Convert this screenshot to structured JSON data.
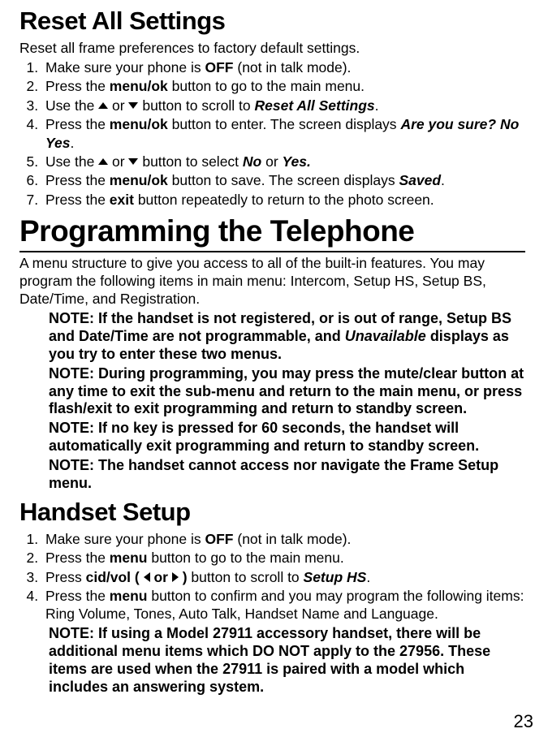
{
  "reset": {
    "title": "Reset All Settings",
    "intro": "Reset all frame preferences to factory default settings.",
    "s1a": "Make sure your phone is ",
    "s1b": "OFF",
    "s1c": " (not in talk mode).",
    "s2a": "Press the ",
    "s2b": "menu/ok",
    "s2c": " button to go to the main menu.",
    "s3a": "Use the ",
    "s3or": " or ",
    "s3b": " button to scroll to ",
    "s3c": "Reset All Settings",
    "s3d": ".",
    "s4a": "Press the ",
    "s4b": "menu/ok",
    "s4c": " button to enter. The screen displays ",
    "s4d": "Are you sure?  No  Yes",
    "s4e": ".",
    "s5a": "Use the ",
    "s5or": " or ",
    "s5b": " button to select ",
    "s5c": "No",
    "s5d": " or ",
    "s5e": "Yes.",
    "s6a": "Press the ",
    "s6b": "menu/ok",
    "s6c": " button to save. The screen displays ",
    "s6d": "Saved",
    "s6e": ".",
    "s7a": "Press the ",
    "s7b": "exit",
    "s7c": " button repeatedly to return to the photo screen."
  },
  "prog": {
    "title": "Programming the Telephone",
    "intro": "A menu structure to give you access to all of the built-in features. You may program the following items in main menu: Intercom, Setup HS, Setup BS, Date/Time, and Registration.",
    "n1a": "NOTE: If the handset is not registered, or is out of range, Setup BS and Date/Time are not programmable, and ",
    "n1b": "Unavailable",
    "n1c": " displays as you try to enter these two menus.",
    "n2": "NOTE: During programming, you may press the mute/clear button at any time to exit the sub-menu and return to the main menu, or press flash/exit to exit programming and return to standby screen.",
    "n3": "NOTE: If no key is pressed for 60 seconds, the handset will automatically exit programming and return to standby screen.",
    "n4": "NOTE: The handset cannot access nor navigate the Frame Setup menu."
  },
  "hs": {
    "title": "Handset Setup",
    "s1a": "Make sure your phone is ",
    "s1b": "OFF",
    "s1c": " (not in talk mode).",
    "s2a": "Press the ",
    "s2b": "menu",
    "s2c": " button to go to the main menu.",
    "s3a": "Press ",
    "s3b": "cid/vol ( ",
    "s3or": " or ",
    "s3b2": " )",
    "s3c": " button to scroll to ",
    "s3d": "Setup HS",
    "s3e": ".",
    "s4a": "Press the ",
    "s4b": "menu",
    "s4c": " button to confirm and you may program the following items: Ring Volume, Tones, Auto Talk, Handset Name and Language.",
    "note": "NOTE: If using a Model 27911 accessory handset, there will be additional menu items which DO NOT apply to the 27956. These items are used when the 27911 is paired with a model which includes an answering system."
  },
  "page": "23"
}
